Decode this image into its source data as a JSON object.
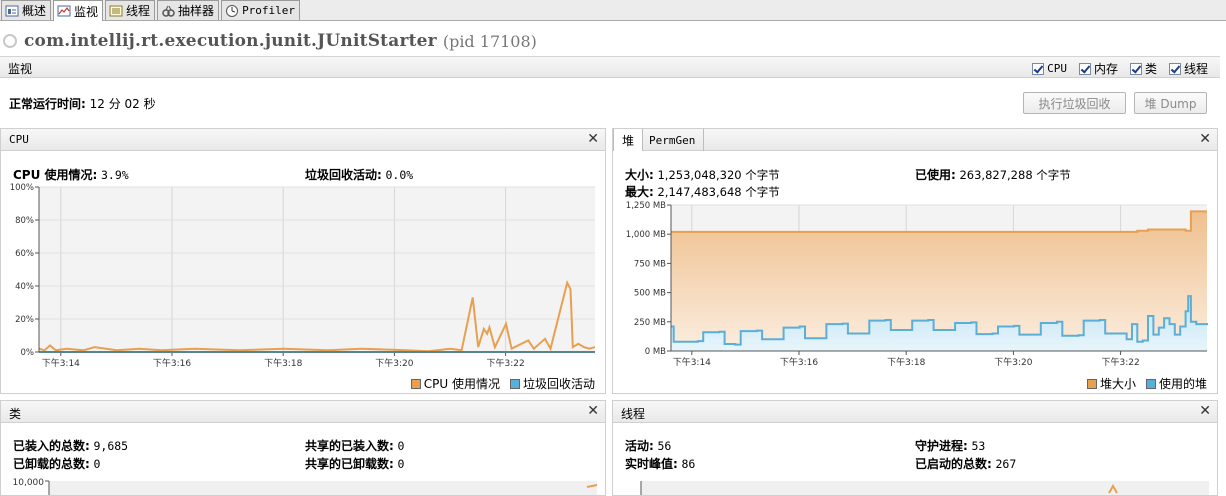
{
  "tabs": [
    {
      "label": "概述",
      "icon": "overview-icon"
    },
    {
      "label": "监视",
      "icon": "monitor-icon",
      "active": true
    },
    {
      "label": "线程",
      "icon": "threads-icon"
    },
    {
      "label": "抽样器",
      "icon": "sampler-icon"
    },
    {
      "label": "Profiler",
      "icon": "profiler-icon"
    }
  ],
  "app": {
    "title": "com.intellij.rt.execution.junit.JUnitStarter",
    "pid": "(pid 17108)"
  },
  "monitor": {
    "title": "监视",
    "checkboxes": [
      {
        "label": "CPU",
        "checked": true
      },
      {
        "label": "内存",
        "checked": true
      },
      {
        "label": "类",
        "checked": true
      },
      {
        "label": "线程",
        "checked": true
      }
    ],
    "uptime_label": "正常运行时间:",
    "uptime_value": "12 分 02 秒",
    "gc_button": "执行垃圾回收",
    "dump_button": "堆 Dump"
  },
  "cpu_panel": {
    "title": "CPU",
    "usage_label": "CPU 使用情况:",
    "usage_value": "3.9%",
    "gc_label": "垃圾回收活动:",
    "gc_value": "0.0%",
    "legend": [
      "CPU 使用情况",
      "垃圾回收活动"
    ]
  },
  "heap_panel": {
    "tab_heap": "堆",
    "tab_permgen": "PermGen",
    "size_label": "大小:",
    "size_value": "1,253,048,320 个字节",
    "max_label": "最大:",
    "max_value": "2,147,483,648 个字节",
    "used_label": "已使用:",
    "used_value": "263,827,288 个字节",
    "legend": [
      "堆大小",
      "使用的堆"
    ]
  },
  "classes_panel": {
    "title": "类",
    "loaded_label": "已装入的总数:",
    "loaded_value": "9,685",
    "unloaded_label": "已卸载的总数:",
    "unloaded_value": "0",
    "shared_loaded_label": "共享的已装入数:",
    "shared_loaded_value": "0",
    "shared_unloaded_label": "共享的已卸载数:",
    "shared_unloaded_value": "0",
    "ytick_top": "10,000"
  },
  "threads_panel": {
    "title": "线程",
    "live_label": "活动:",
    "live_value": "56",
    "peak_label": "实时峰值:",
    "peak_value": "86",
    "daemon_label": "守护进程:",
    "daemon_value": "53",
    "started_label": "已启动的总数:",
    "started_value": "267"
  },
  "colors": {
    "cpu": "#e8a050",
    "gc": "#5aaed8",
    "heap_size": "#e8a050",
    "heap_used": "#5aaed8"
  },
  "chart_data": [
    {
      "type": "line",
      "title": "CPU",
      "x": [
        "下午3:14",
        "下午3:16",
        "下午3:18",
        "下午3:20",
        "下午3:22"
      ],
      "yticks": [
        "0%",
        "20%",
        "40%",
        "60%",
        "80%",
        "100%"
      ],
      "ylim": [
        0,
        100
      ],
      "series": [
        {
          "name": "CPU 使用情况",
          "points": [
            [
              0,
              2
            ],
            [
              1,
              1
            ],
            [
              2,
              4
            ],
            [
              3,
              1
            ],
            [
              5,
              2
            ],
            [
              8,
              1
            ],
            [
              10,
              3
            ],
            [
              14,
              1
            ],
            [
              18,
              2
            ],
            [
              22,
              1
            ],
            [
              28,
              2
            ],
            [
              36,
              1
            ],
            [
              44,
              2
            ],
            [
              52,
              1
            ],
            [
              58,
              2
            ],
            [
              66,
              1
            ],
            [
              70,
              0.5
            ],
            [
              74,
              2
            ],
            [
              76,
              1
            ],
            [
              78,
              33
            ],
            [
              79,
              3
            ],
            [
              80,
              14
            ],
            [
              80.6,
              11
            ],
            [
              81,
              15
            ],
            [
              82,
              3
            ],
            [
              84,
              17
            ],
            [
              85,
              2
            ],
            [
              88,
              7
            ],
            [
              89,
              2
            ],
            [
              91,
              8
            ],
            [
              92,
              2
            ],
            [
              95,
              42
            ],
            [
              95.6,
              38
            ],
            [
              96,
              3
            ],
            [
              97,
              5
            ],
            [
              98,
              3
            ],
            [
              99,
              2
            ],
            [
              100,
              3
            ]
          ]
        },
        {
          "name": "垃圾回收活动",
          "points": [
            [
              0,
              0
            ],
            [
              100,
              0
            ]
          ]
        }
      ]
    },
    {
      "type": "area",
      "title": "堆",
      "x": [
        "下午3:14",
        "下午3:16",
        "下午3:18",
        "下午3:20",
        "下午3:22"
      ],
      "yticks": [
        "0 MB",
        "250 MB",
        "500 MB",
        "750 MB",
        "1,000 MB",
        "1,250 MB"
      ],
      "ylim": [
        0,
        1250
      ],
      "series": [
        {
          "name": "堆大小",
          "points": [
            [
              0,
              1020
            ],
            [
              86,
              1020
            ],
            [
              87,
              1030
            ],
            [
              89,
              1040
            ],
            [
              94,
              1040
            ],
            [
              96,
              1030
            ],
            [
              97,
              1195
            ],
            [
              100,
              1195
            ]
          ]
        },
        {
          "name": "使用的堆",
          "points": [
            [
              0,
              210
            ],
            [
              0.5,
              80
            ],
            [
              5,
              85
            ],
            [
              6,
              160
            ],
            [
              9,
              165
            ],
            [
              10,
              60
            ],
            [
              12,
              55
            ],
            [
              13,
              170
            ],
            [
              16,
              175
            ],
            [
              17,
              100
            ],
            [
              20,
              100
            ],
            [
              21,
              200
            ],
            [
              24,
              210
            ],
            [
              25,
              110
            ],
            [
              28,
              110
            ],
            [
              29,
              230
            ],
            [
              32,
              235
            ],
            [
              33,
              150
            ],
            [
              36,
              150
            ],
            [
              37,
              260
            ],
            [
              40,
              265
            ],
            [
              41,
              180
            ],
            [
              44,
              180
            ],
            [
              45,
              260
            ],
            [
              48,
              265
            ],
            [
              49,
              180
            ],
            [
              52,
              180
            ],
            [
              53,
              240
            ],
            [
              56,
              245
            ],
            [
              57,
              145
            ],
            [
              60,
              150
            ],
            [
              61,
              210
            ],
            [
              64,
              215
            ],
            [
              65,
              140
            ],
            [
              68,
              140
            ],
            [
              69,
              240
            ],
            [
              72,
              250
            ],
            [
              73,
              130
            ],
            [
              76,
              135
            ],
            [
              77,
              260
            ],
            [
              80,
              265
            ],
            [
              81,
              150
            ],
            [
              84,
              150
            ],
            [
              85,
              100
            ],
            [
              86,
              230
            ],
            [
              87,
              80
            ],
            [
              88,
              90
            ],
            [
              89,
              300
            ],
            [
              90,
              140
            ],
            [
              91,
              200
            ],
            [
              92,
              280
            ],
            [
              93,
              230
            ],
            [
              94,
              140
            ],
            [
              95,
              210
            ],
            [
              96,
              340
            ],
            [
              96.5,
              470
            ],
            [
              97,
              250
            ],
            [
              98,
              230
            ],
            [
              100,
              240
            ]
          ]
        }
      ]
    }
  ]
}
